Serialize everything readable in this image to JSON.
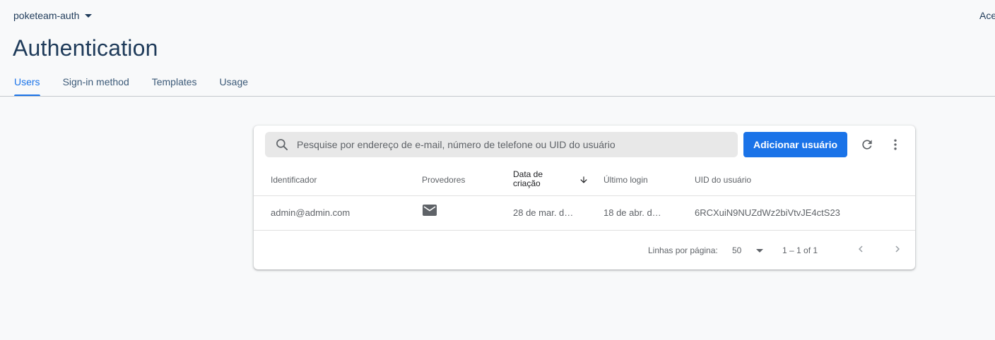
{
  "header": {
    "project_name": "poketeam-auth",
    "top_right_text": "Ace",
    "page_title": "Authentication"
  },
  "tabs": [
    {
      "label": "Users",
      "active": true
    },
    {
      "label": "Sign-in method",
      "active": false
    },
    {
      "label": "Templates",
      "active": false
    },
    {
      "label": "Usage",
      "active": false
    }
  ],
  "toolbar": {
    "search_placeholder": "Pesquise por endereço de e-mail, número de telefone ou UID do usuário",
    "search_value": "",
    "add_user_label": "Adicionar usuário",
    "refresh_icon": "refresh-icon",
    "more_icon": "more-vert-icon"
  },
  "table": {
    "columns": [
      "Identificador",
      "Provedores",
      "Data de criação",
      "Último login",
      "UID do usuário"
    ],
    "sorted_column_line1": "Data de",
    "sorted_column_line2": "criação",
    "rows": [
      {
        "identifier": "admin@admin.com",
        "provider_icon": "email-icon",
        "created": "28 de mar. d…",
        "last_login": "18 de abr. d…",
        "uid": "6RCXuiN9NUZdWz2biVtvJE4ctS23"
      }
    ]
  },
  "pagination": {
    "rows_per_page_label": "Linhas por página:",
    "rows_per_page_value": "50",
    "range_text": "1 – 1 of 1"
  },
  "colors": {
    "accent": "#1a73e8",
    "title": "#1f3b5a",
    "background": "#f8f9fa"
  }
}
